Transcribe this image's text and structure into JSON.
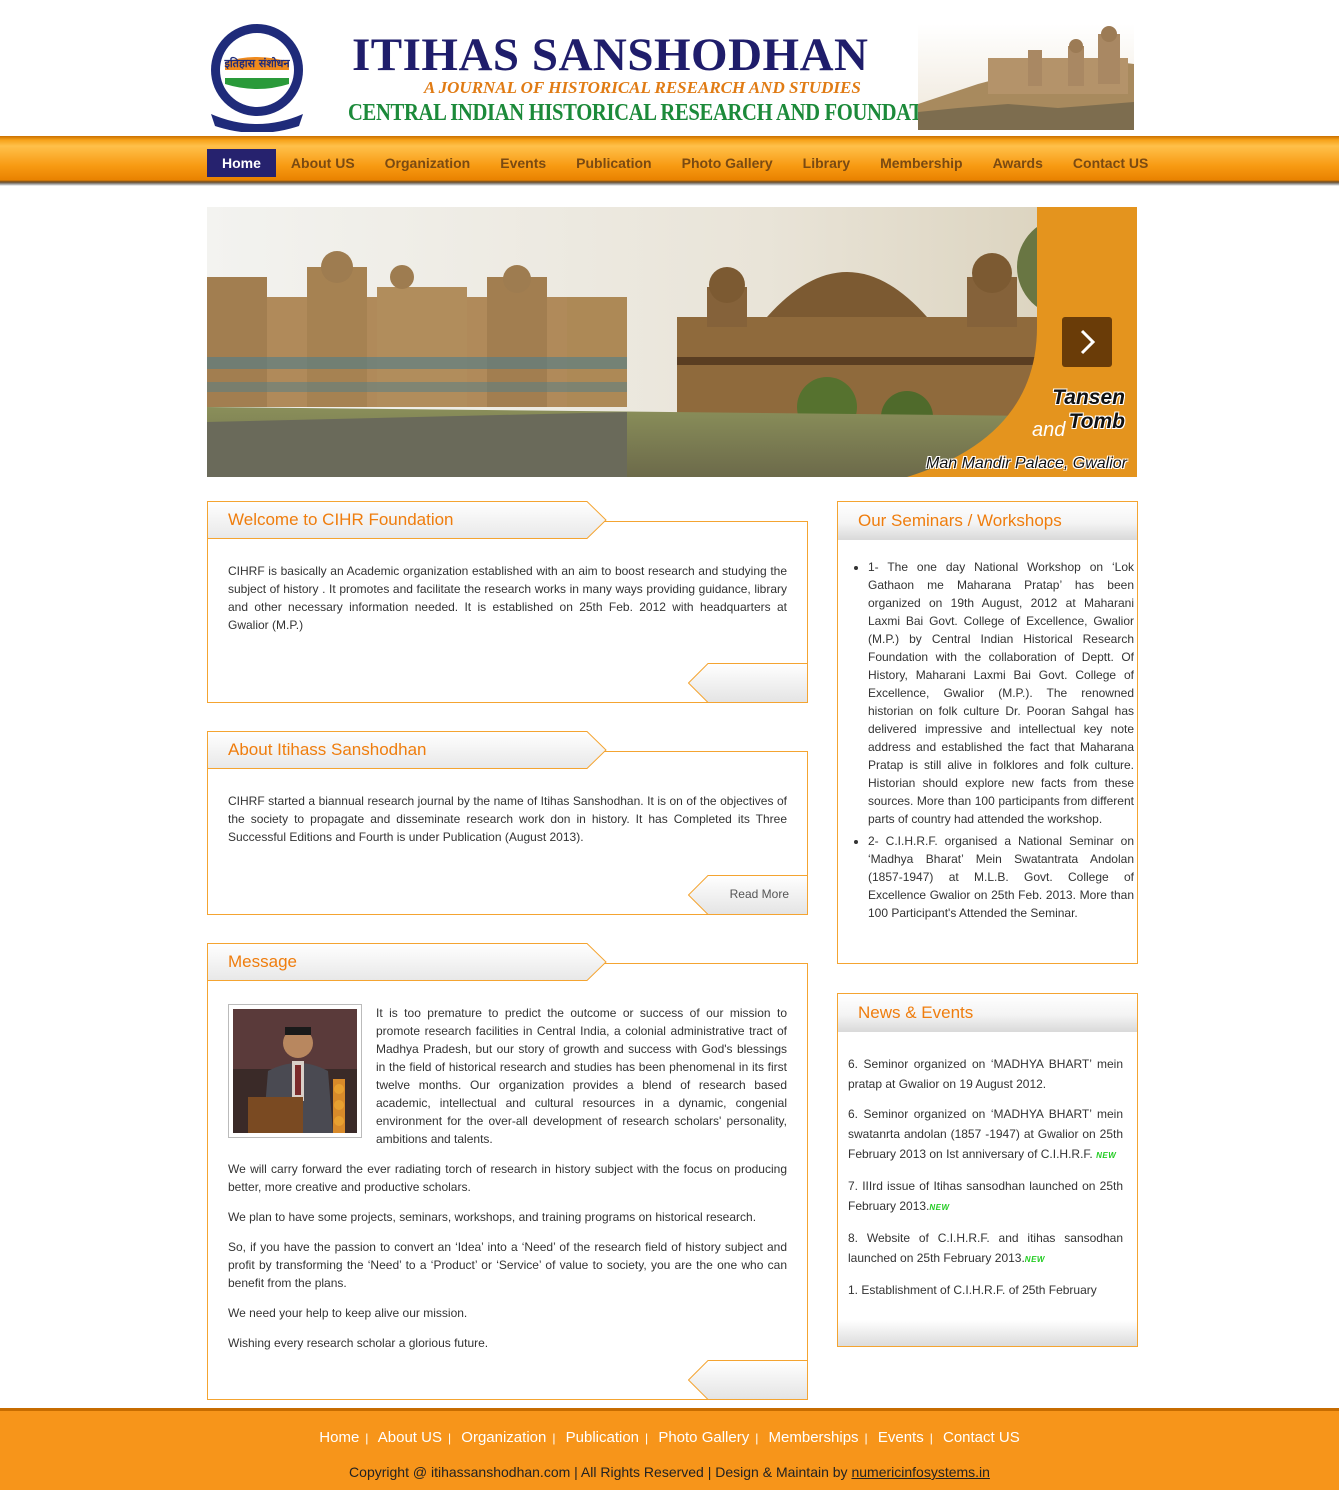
{
  "header": {
    "title": "ITIHAS SANSHODHAN",
    "tagline": "A JOURNAL OF HISTORICAL RESEARCH AND STUDIES",
    "org": "CENTRAL INDIAN HISTORICAL RESEARCH AND FOUNDATION",
    "logo_text": "इतिहास संशोधन"
  },
  "nav": {
    "items": [
      "Home",
      "About US",
      "Organization",
      "Events",
      "Publication",
      "Photo Gallery",
      "Library",
      "Membership",
      "Awards",
      "Contact US"
    ]
  },
  "banner": {
    "caption_line1": "Tansen Tomb",
    "caption_line2": "and",
    "caption_line3": "Man Mandir Palace, Gwalior"
  },
  "welcome": {
    "title": "Welcome to CIHR Foundation",
    "text": "CIHRF is basically an Academic organization established with an aim to boost research and studying the subject of history . It promotes and facilitate the research works in many ways providing guidance, library and other necessary information needed. It is established on 25th Feb. 2012 with headquarters at Gwalior (M.P.)"
  },
  "about": {
    "title": "About Itihass Sanshodhan",
    "text": "CIHRF started a biannual research journal by the name of Itihas Sanshodhan. It is on of the objectives of the society to propagate and disseminate research work don in history. It has Completed its Three Successful Editions and Fourth is under Publication (August 2013).",
    "read_more": "Read More"
  },
  "message": {
    "title": "Message",
    "paragraphs": [
      "It is too premature to predict the outcome or success of our mission to promote research facilities in Central India, a colonial administrative tract of Madhya Pradesh, but our story of growth and success with God's blessings in the field of historical research and studies has been phenomenal in its first twelve months. Our organization provides a blend of research based academic, intellectual and cultural resources in a dynamic, congenial environment for the over-all development of research scholars' personality, ambitions and talents.",
      "We will carry forward the ever radiating torch of research in history subject with the focus on producing better, more creative and productive scholars.",
      "We plan to have some projects, seminars, workshops, and training programs on historical research.",
      "So, if you have the passion to convert an ‘Idea’ into a ‘Need’ of the research field of history subject and profit by transforming the ‘Need’ to a ‘Product’ or ‘Service’ of value to society, you are the one who can benefit from the plans.",
      "We need your help to keep alive our mission.",
      "Wishing every research scholar a glorious future."
    ]
  },
  "seminars": {
    "title": "Our Seminars / Workshops",
    "items": [
      "1- The one day National Workshop on ‘Lok Gathaon me Maharana Pratap’ has been organized on 19th August, 2012 at Maharani Laxmi Bai Govt. College of Excellence, Gwalior (M.P.) by Central Indian Historical Research Foundation with the collaboration of Deptt. Of History, Maharani Laxmi Bai Govt. College of Excellence, Gwalior (M.P.). The renowned historian on folk culture Dr. Pooran Sahgal has delivered impressive and intellectual key note address and established the fact that Maharana Pratap is still alive in folklores and folk culture. Historian should explore new facts from these sources. More than 100 participants from different parts of country had attended the workshop.",
      "2- C.I.H.R.F. organised a National Seminar on ‘Madhya Bharat’ Mein Swatantrata Andolan (1857-1947) at M.L.B. Govt. College of Excellence Gwalior on 25th Feb. 2013. More than 100 Participant's Attended the Seminar."
    ]
  },
  "news": {
    "title": "News & Events",
    "new_label": "NEW",
    "items": [
      "6. Seminor organized on ‘MADHYA BHART’ mein pratap at Gwalior on 19 August 2012.",
      "6. Seminor organized on ‘MADHYA BHART’ mein swatanrta andolan (1857 -1947) at Gwalior on 25th February 2013 on Ist anniversary of C.I.H.R.F.",
      "7. IIIrd issue of Itihas sansodhan launched on 25th February 2013.",
      "8. Website of C.I.H.R.F. and itihas sansodhan launched on 25th February 2013.",
      "1. Establishment of C.I.H.R.F. of 25th February"
    ]
  },
  "footer": {
    "links": [
      "Home",
      "About US",
      "Organization",
      "Publication",
      "Photo Gallery",
      "Memberships",
      "Events",
      "Contact US"
    ],
    "copyright": "Copyright @ itihassanshodhan.com | All Rights Reserved | Design & Maintain by",
    "designer_link": "numericinfosystems.in"
  },
  "colors": {
    "accent": "#ef7d0d",
    "nav_active": "#26226e",
    "title_blue": "#1f1d6b",
    "org_green": "#1c8a3a",
    "footer_bg": "#f7951a"
  }
}
